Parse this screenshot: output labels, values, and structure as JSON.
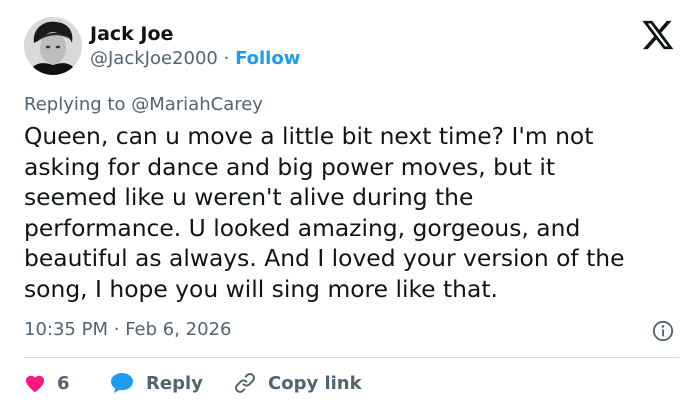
{
  "author": {
    "name": "Jack Joe",
    "handle": "@JackJoe2000",
    "separator": "·",
    "follow_label": "Follow"
  },
  "logo_icon": "x-logo-icon",
  "replying": {
    "prefix": "Replying to",
    "mention": "@MariahCarey"
  },
  "tweet": {
    "lines": [
      "Queen, can u move a little bit next time? I'm not",
      "asking for dance and big power moves, but it",
      "seemed like u weren't alive during the",
      "performance. U looked amazing, gorgeous, and",
      "beautiful as always. And I loved your version of the",
      "song, I hope you will sing more like that."
    ]
  },
  "meta": {
    "time": "10:35 PM",
    "separator": "·",
    "date": "Feb 6, 2026"
  },
  "actions": {
    "like_count": "6",
    "reply_label": "Reply",
    "copy_label": "Copy link"
  },
  "colors": {
    "accent": "#1d9bf0",
    "like": "#f91880",
    "secondary_text": "#536471",
    "primary_text": "#0f1419",
    "divider": "#cfd9de"
  }
}
